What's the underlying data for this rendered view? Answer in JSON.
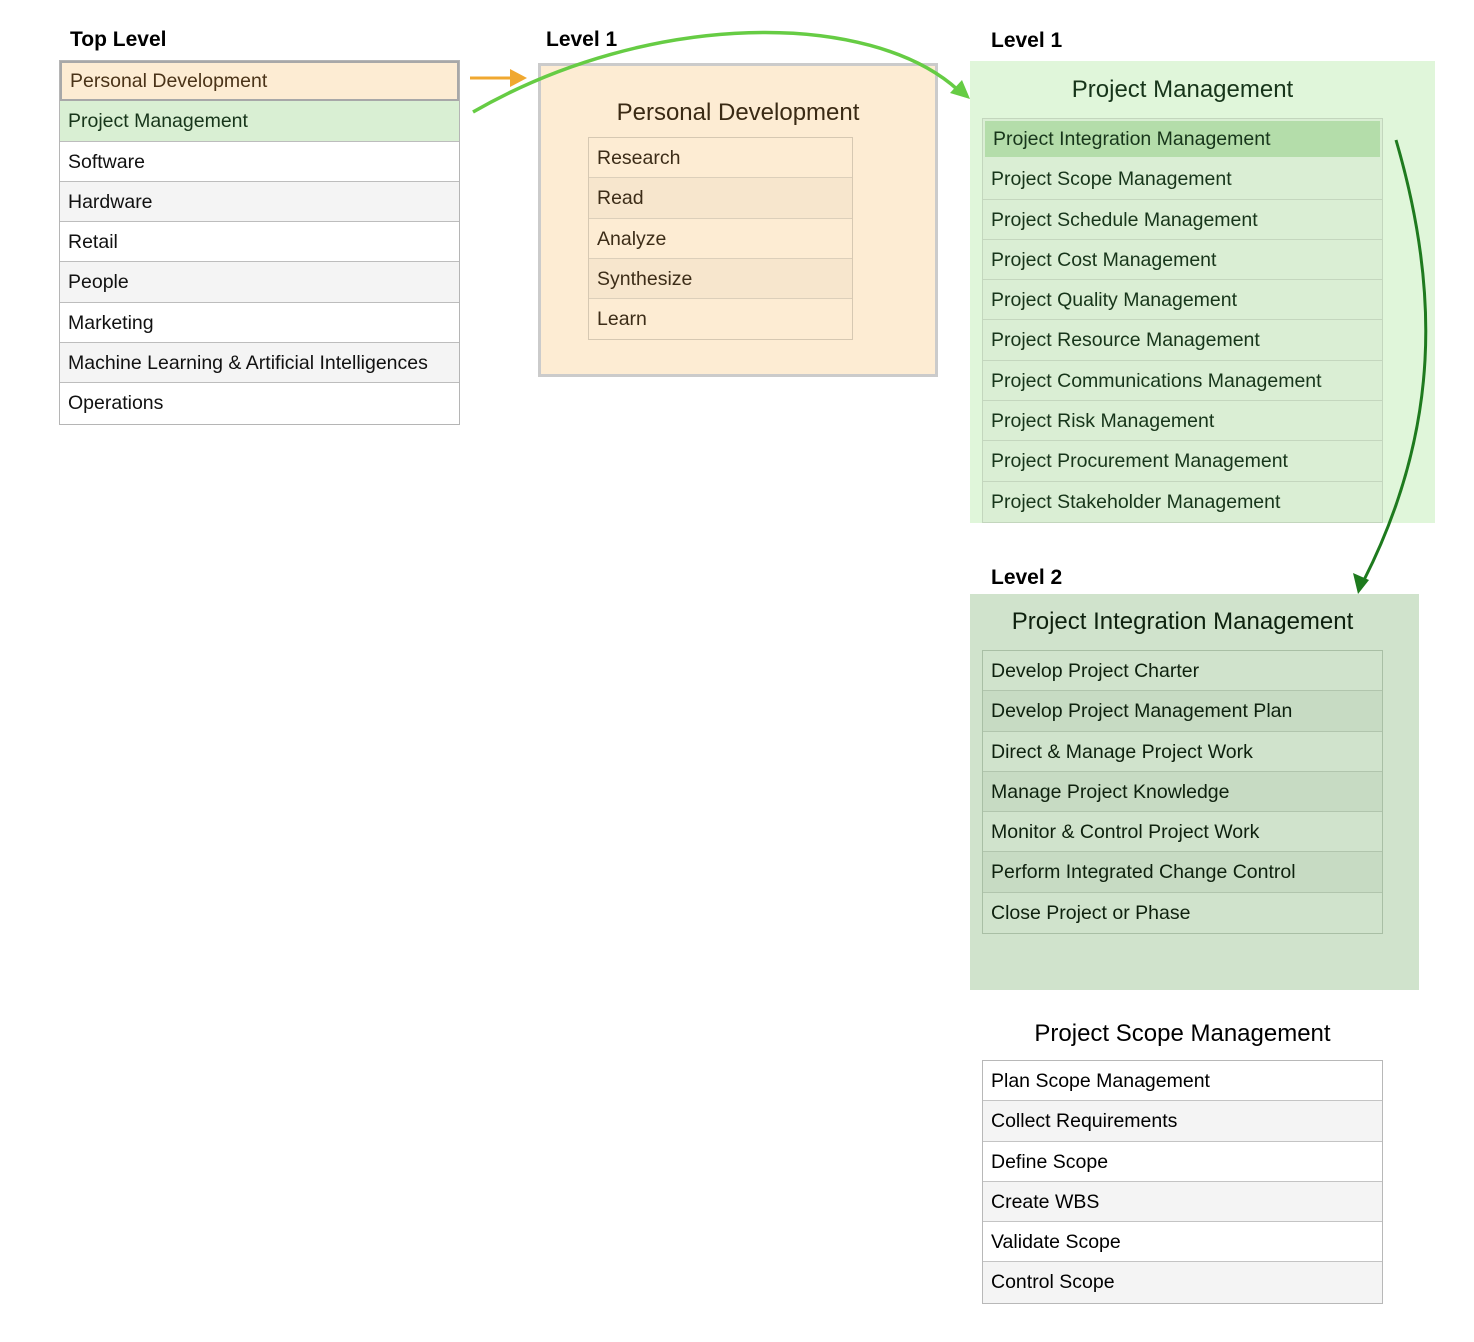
{
  "headings": {
    "top_level": "Top Level",
    "level1_left": "Level 1",
    "level1_right": "Level 1",
    "level2": "Level 2"
  },
  "top_level": {
    "items": [
      "Personal Development",
      "Project Management",
      "Software",
      "Hardware",
      "Retail",
      "People",
      "Marketing",
      "Machine Learning & Artificial Intelligences",
      "Operations"
    ]
  },
  "personal_development": {
    "title": "Personal Development",
    "items": [
      "Research",
      "Read",
      "Analyze",
      "Synthesize",
      "Learn"
    ]
  },
  "project_management": {
    "title": "Project Management",
    "items": [
      "Project Integration Management",
      "Project Scope Management",
      "Project Schedule Management",
      "Project Cost Management",
      "Project Quality Management",
      "Project Resource Management",
      "Project Communications Management",
      "Project Risk Management",
      "Project Procurement Management",
      "Project Stakeholder Management"
    ]
  },
  "integration_management": {
    "title": "Project Integration Management",
    "items": [
      "Develop Project Charter",
      "Develop Project Management Plan",
      "Direct & Manage Project Work",
      "Manage Project Knowledge",
      "Monitor & Control Project Work",
      "Perform Integrated Change Control",
      "Close Project or Phase"
    ]
  },
  "scope_management": {
    "title": "Project Scope Management",
    "items": [
      "Plan Scope Management",
      "Collect Requirements",
      "Define Scope",
      "Create WBS",
      "Validate Scope",
      "Control Scope"
    ]
  },
  "colors": {
    "orange_arrow": "#f0a830",
    "light_green_arrow": "#66cc44",
    "dark_green_arrow": "#1e7a1e"
  }
}
